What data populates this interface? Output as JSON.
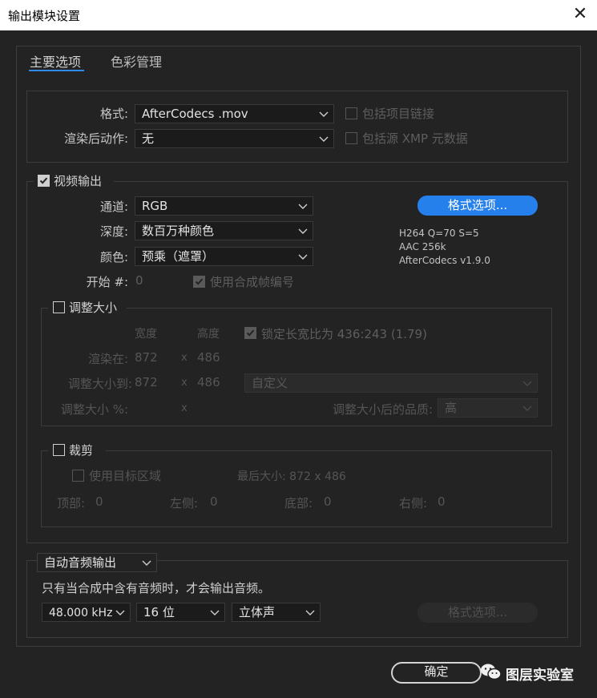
{
  "window": {
    "title": "输出模块设置",
    "close_glyph": "✕"
  },
  "tabs": [
    {
      "label": "主要选项"
    },
    {
      "label": "色彩管理"
    }
  ],
  "format": {
    "format_label": "格式:",
    "format_value": "AfterCodecs .mov",
    "post_render_label": "渲染后动作:",
    "post_render_value": "无",
    "include_project_link": "包括项目链接",
    "include_xmp": "包括源 XMP 元数据"
  },
  "video": {
    "header": "视频输出",
    "channels_label": "通道:",
    "channels_value": "RGB",
    "depth_label": "深度:",
    "depth_value": "数百万种颜色",
    "color_label": "颜色:",
    "color_value": "预乘（遮罩）",
    "start_label": "开始 #:",
    "start_value": "0",
    "use_comp_frame": "使用合成帧编号",
    "format_options_btn": "格式选项...",
    "codec_info": [
      "H264 Q=70 S=5",
      "AAC 256k",
      "AfterCodecs v1.9.0"
    ]
  },
  "resize": {
    "header": "调整大小",
    "width_col": "宽度",
    "height_col": "高度",
    "lock_aspect": "锁定长宽比为 436:243 (1.79)",
    "render_at_label": "渲染在:",
    "render_at_w": "872",
    "render_at_x": "x",
    "render_at_h": "486",
    "resize_to_label": "调整大小到:",
    "resize_to_w": "872",
    "resize_to_x": "x",
    "resize_to_h": "486",
    "resize_to_preset": "自定义",
    "resize_pct_label": "调整大小 %:",
    "resize_pct_x": "x",
    "quality_label": "调整大小后的品质:",
    "quality_value": "高"
  },
  "crop": {
    "header": "裁剪",
    "use_roi": "使用目标区域",
    "final_size": "最后大小: 872 x 486",
    "top_label": "顶部:",
    "top_value": "0",
    "left_label": "左侧:",
    "left_value": "0",
    "bottom_label": "底部:",
    "bottom_value": "0",
    "right_label": "右侧:",
    "right_value": "0"
  },
  "audio": {
    "mode_value": "自动音频输出",
    "note": "只有当合成中含有音频时，才会输出音频。",
    "rate_value": "48.000 kHz",
    "bits_value": "16 位",
    "channels_value": "立体声",
    "format_options_btn": "格式选项..."
  },
  "footer": {
    "ok_label": "确定",
    "watermark": "图层实验室"
  },
  "colors": {
    "accent": "#2680eb",
    "background": "#232323",
    "titlebar": "#ffffff"
  }
}
